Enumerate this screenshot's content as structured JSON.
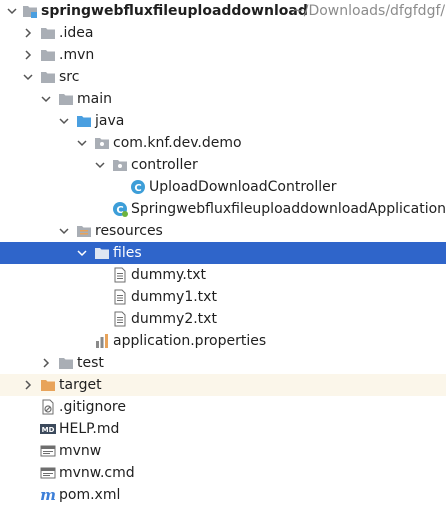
{
  "project": {
    "name": "springwebfluxfileuploaddownload",
    "path": "~/Downloads/dfgfdgf/"
  },
  "tree": {
    "idea": ".idea",
    "mvn": ".mvn",
    "src": "src",
    "main": "main",
    "java": "java",
    "package": "com.knf.dev.demo",
    "controller": "controller",
    "controller_class": "UploadDownloadController",
    "app_class": "SpringwebfluxfileuploaddownloadApplication",
    "resources": "resources",
    "files": "files",
    "file1": "dummy.txt",
    "file2": "dummy1.txt",
    "file3": "dummy2.txt",
    "properties": "application.properties",
    "test": "test",
    "target": "target",
    "gitignore": ".gitignore",
    "help": "HELP.md",
    "mvnw": "mvnw",
    "mvnwcmd": "mvnw.cmd",
    "pom": "pom.xml"
  },
  "colors": {
    "selection": "#2f65ca",
    "folder": "#a9aeb5",
    "source_folder": "#4a9fe0",
    "target_folder": "#e8a35a",
    "class_icon": "#3d9ed8"
  }
}
